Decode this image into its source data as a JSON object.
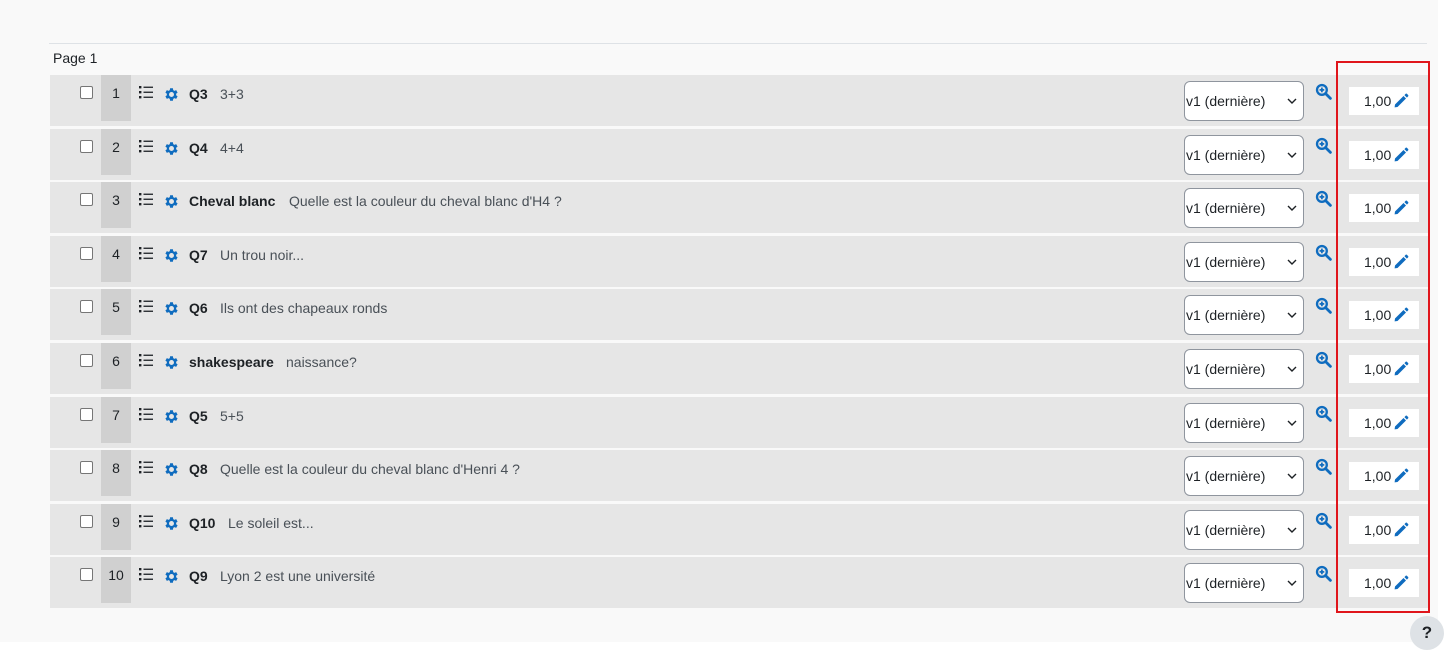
{
  "page_label": "Page 1",
  "colors": {
    "icon_blue": "#0f6cbf",
    "highlight_red": "#e0161c",
    "slot_bg": "#e6e6e6"
  },
  "icons": {
    "move": "list-move-icon",
    "edit": "gear-icon",
    "preview": "zoom-in-icon",
    "mark_edit": "pencil-icon"
  },
  "slots": [
    {
      "number": "1",
      "name": "Q3",
      "text": "3+3",
      "version": "v1 (dernière)",
      "mark": "1,00"
    },
    {
      "number": "2",
      "name": "Q4",
      "text": "4+4",
      "version": "v1 (dernière)",
      "mark": "1,00"
    },
    {
      "number": "3",
      "name": "Cheval blanc",
      "text": "Quelle est la couleur du cheval blanc d'H4 ?",
      "version": "v1 (dernière)",
      "mark": "1,00"
    },
    {
      "number": "4",
      "name": "Q7",
      "text": "Un trou noir...",
      "version": "v1 (dernière)",
      "mark": "1,00"
    },
    {
      "number": "5",
      "name": "Q6",
      "text": "Ils ont des chapeaux ronds",
      "version": "v1 (dernière)",
      "mark": "1,00"
    },
    {
      "number": "6",
      "name": "shakespeare",
      "text": "naissance?",
      "version": "v1 (dernière)",
      "mark": "1,00"
    },
    {
      "number": "7",
      "name": "Q5",
      "text": "5+5",
      "version": "v1 (dernière)",
      "mark": "1,00"
    },
    {
      "number": "8",
      "name": "Q8",
      "text": "Quelle est la couleur du cheval blanc d'Henri 4 ?",
      "version": "v1 (dernière)",
      "mark": "1,00"
    },
    {
      "number": "9",
      "name": "Q10",
      "text": "Le soleil est...",
      "version": "v1 (dernière)",
      "mark": "1,00"
    },
    {
      "number": "10",
      "name": "Q9",
      "text": "Lyon 2 est une université",
      "version": "v1 (dernière)",
      "mark": "1,00"
    }
  ],
  "help_button": "?"
}
